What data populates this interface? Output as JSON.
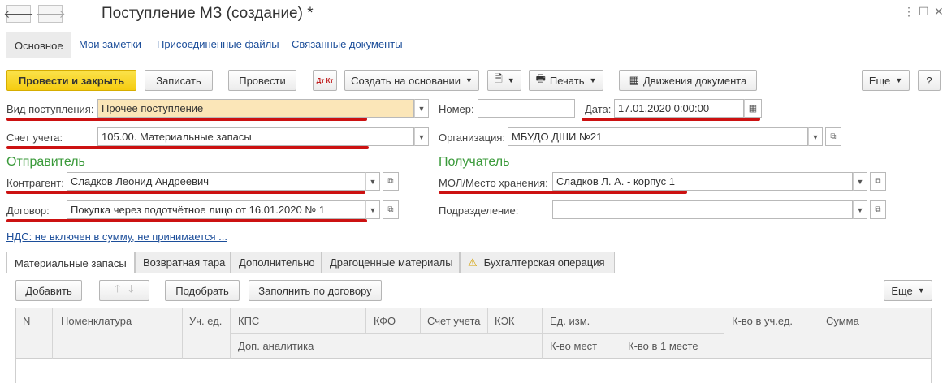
{
  "window": {
    "title": "Поступление МЗ (создание) *",
    "back_glyph": "🡐",
    "forward_glyph": "🡒",
    "menu_glyph": "⋮",
    "maximize_glyph": "☐",
    "close_glyph": "✕"
  },
  "top_tabs": [
    {
      "label": "Основное"
    },
    {
      "label": "Мои заметки"
    },
    {
      "label": "Присоединенные файлы"
    },
    {
      "label": "Связанные документы"
    }
  ],
  "toolbar": {
    "post_close": "Провести и закрыть",
    "save": "Записать",
    "post": "Провести",
    "dtkt_icon_text": "Дт Кт",
    "create_based": "Создать на основании",
    "print": "Печать",
    "movements": "Движения документа",
    "more": "Еще",
    "help": "?"
  },
  "form": {
    "receipt_type_label": "Вид поступления:",
    "receipt_type_value": "Прочее поступление",
    "number_label": "Номер:",
    "number_value": "",
    "date_label": "Дата:",
    "date_value": "17.01.2020  0:00:00",
    "account_label": "Счет учета:",
    "account_value": "105.00. Материальные запасы",
    "org_label": "Организация:",
    "org_value": "МБУДО ДШИ  №21",
    "sender_header": "Отправитель",
    "receiver_header": "Получатель",
    "counterparty_label": "Контрагент:",
    "counterparty_value": "Сладков Леонид Андреевич",
    "mol_label": "МОЛ/Место хранения:",
    "mol_value": "Сладков Л. А. - корпус 1",
    "contract_label": "Договор:",
    "contract_value": "Покупка через подотчётное лицо от 16.01.2020 № 1",
    "division_label": "Подразделение:",
    "division_value": "",
    "vat_link": "НДС: не включен в сумму, не принимается ..."
  },
  "doc_tabs": [
    {
      "label": "Материальные запасы"
    },
    {
      "label": "Возвратная тара"
    },
    {
      "label": "Дополнительно"
    },
    {
      "label": "Драгоценные материалы"
    },
    {
      "label": "Бухгалтерская операция"
    }
  ],
  "table_toolbar": {
    "add": "Добавить",
    "pick": "Подобрать",
    "fill_by_contract": "Заполнить по договору",
    "more": "Еще"
  },
  "table": {
    "headers": {
      "n": "N",
      "item": "Номенклатура",
      "unit": "Уч. ед.",
      "kps": "КПС",
      "kfo": "КФО",
      "account": "Счет учета",
      "kek": "КЭК",
      "measure": "Ед. изм.",
      "qty_unit": "К-во в уч.ед.",
      "sum": "Сумма",
      "extra_analytics": "Доп. аналитика",
      "places": "К-во мест",
      "per_place": "К-во в 1 месте"
    },
    "rows": []
  },
  "colors": {
    "accent_yellow": "#f5cc10",
    "highlight_field": "#fbe6b8",
    "section_green": "#3a9a3a",
    "link_blue": "#1c4e9a",
    "annotation_red": "#cc1111"
  }
}
